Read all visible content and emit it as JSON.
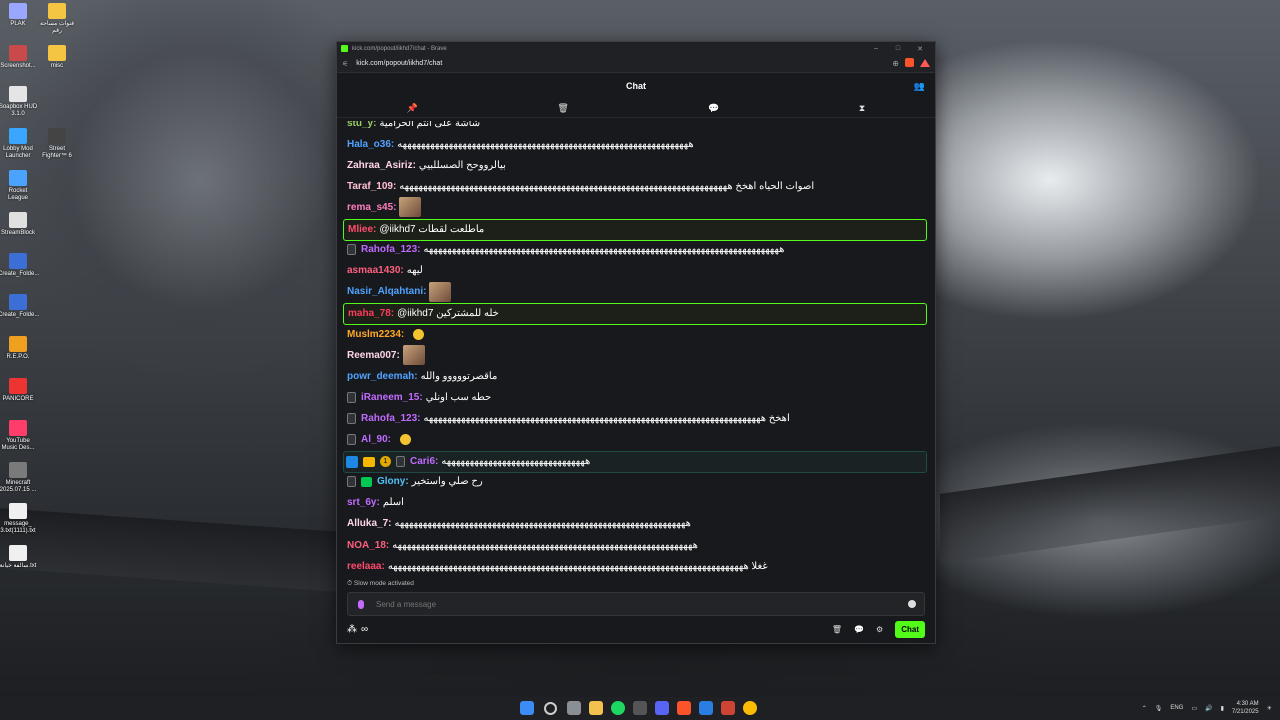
{
  "desktop_icons_left": [
    {
      "label": "PLAK",
      "color": "#9aa7ff"
    },
    {
      "label": "Screenshot...",
      "color": "#c94a4a"
    },
    {
      "label": "Soapbox HUD 3.1.0",
      "color": "#e5e5e5"
    },
    {
      "label": "Lobby Mod Launcher",
      "color": "#3aa6ff"
    },
    {
      "label": "Rocket League",
      "color": "#4aa3ff"
    },
    {
      "label": "StreamBlock",
      "color": "#e0e0e0"
    },
    {
      "label": "Create_Folde...",
      "color": "#3c6fd6"
    },
    {
      "label": "Create_Folde...",
      "color": "#3c6fd6"
    },
    {
      "label": "R.E.P.O.",
      "color": "#f0a020"
    },
    {
      "label": "PANICORE",
      "color": "#e33"
    },
    {
      "label": "YouTube Music Des...",
      "color": "#ff3d6b"
    },
    {
      "label": "Minecraft 2025.07.15 ...",
      "color": "#7a7a7a"
    },
    {
      "label": "message_ 3.txt(1111).txt",
      "color": "#f0f0f0"
    },
    {
      "label": "سالفة خيانة.txt",
      "color": "#f0f0f0"
    }
  ],
  "desktop_icons_right": [
    {
      "label": "قنوات مساحة رقم",
      "color": "#f4c542"
    },
    {
      "label": "misc",
      "color": "#f4c542"
    },
    {
      "label": "Street Fighter™ 6",
      "color": "#444"
    }
  ],
  "browser": {
    "window_title": "kick.com/popout/iikhd7/chat - Brave",
    "url": "kick.com/popout/iikhd7/chat",
    "min_label": "–",
    "max_label": "□",
    "close_label": "✕"
  },
  "chat": {
    "header_title": "Chat",
    "pinned_icons": [
      "pin-icon",
      "trash-icon",
      "comment-icon",
      "hourglass-icon"
    ],
    "messages": [
      {
        "user": "stu_y:",
        "color": "#9ccc65",
        "text": "شاشة على انتم الحرامية",
        "kind": "normal"
      },
      {
        "user": "Hala_o36:",
        "color": "#4fa3ff",
        "text": "هههههههههههههههههههههههههههههههههههههههههههههههههههههههههههههههه",
        "kind": "normal"
      },
      {
        "user": "Zahraa_Asiriz:",
        "color": "#ffd6e7",
        "text": "بيالرووحح الصسللبيي",
        "kind": "normal"
      },
      {
        "user": "Taraf_109:",
        "color": "#ffc1d4",
        "text": "اصوات الحياه اهخخ هههههههههههههههههههههههههههههههههههههههههههههههههههههههههههههههههههههههه",
        "kind": "normal"
      },
      {
        "user": "rema_s45:",
        "color": "#ff7fbf",
        "text": "",
        "kind": "emote"
      },
      {
        "user": "Mliee:",
        "color": "#ff4b6e",
        "text": "@iikhd7 ماطلعت لقطات",
        "kind": "highlight"
      },
      {
        "user": "Rahofa_123:",
        "color": "#c06bff",
        "text": "هههههههههههههههههههههههههههههههههههههههههههههههههههههههههههههههههههههههههههههه",
        "kind": "mod"
      },
      {
        "user": "asmaa1430:",
        "color": "#ff5f7f",
        "text": "ليهه",
        "kind": "normal"
      },
      {
        "user": "Nasir_Alqahtani:",
        "color": "#4fa3ff",
        "text": "",
        "kind": "emote"
      },
      {
        "user": "maha_78:",
        "color": "#ff3b5c",
        "text": "@iikhd7 خله للمشتركين",
        "kind": "highlight"
      },
      {
        "user": "Muslm2234:",
        "color": "#ffa726",
        "text": "",
        "kind": "smile"
      },
      {
        "user": "Reema007:",
        "color": "#ffd6e7",
        "text": "",
        "kind": "emote"
      },
      {
        "user": "powr_deemah:",
        "color": "#4fa3ff",
        "text": "ماقصرتووووو والله",
        "kind": "normal"
      },
      {
        "user": "iRaneem_15:",
        "color": "#c06bff",
        "text": "حطه سب اونلي",
        "kind": "mod"
      },
      {
        "user": "Rahofa_123:",
        "color": "#c06bff",
        "text": "اهخخ هههههههههههههههههههههههههههههههههههههههههههههههههههههههههههههههههههههههههه",
        "kind": "mod"
      },
      {
        "user": "Al_90:",
        "color": "#c06bff",
        "text": "",
        "kind": "mod-smile"
      },
      {
        "user": "Cari6:",
        "color": "#c06bff",
        "text": "هههههههههههههههههههههههههههههههه",
        "kind": "sub"
      },
      {
        "user": "Glony:",
        "color": "#4fc3f7",
        "text": "رح صلي واستخير",
        "kind": "mod-green"
      },
      {
        "user": "srt_6y:",
        "color": "#c06bff",
        "text": "اسلم",
        "kind": "normal"
      },
      {
        "user": "Alluka_7:",
        "color": "#ffd6e7",
        "text": "هههههههههههههههههههههههههههههههههههههههههههههههههههههههههههههههه",
        "kind": "normal"
      },
      {
        "user": "NOA_18:",
        "color": "#ff5f7f",
        "text": "هههههههههههههههههههههههههههههههههههههههههههههههههههههههههههههههههه",
        "kind": "normal"
      },
      {
        "user": "reelaaa:",
        "color": "#ff4b6e",
        "text": "غغلا هههههههههههههههههههههههههههههههههههههههههههههههههههههههههههههههههههههههههههههه",
        "kind": "normal"
      }
    ],
    "coin_badge": "1",
    "slow_mode": "Slow mode activated",
    "input_placeholder": "Send a message",
    "chat_button": "Chat",
    "infinity_label": "∞"
  },
  "taskbar": {
    "lang": "ENG",
    "time": "4:30 AM",
    "date": "7/21/2025"
  }
}
